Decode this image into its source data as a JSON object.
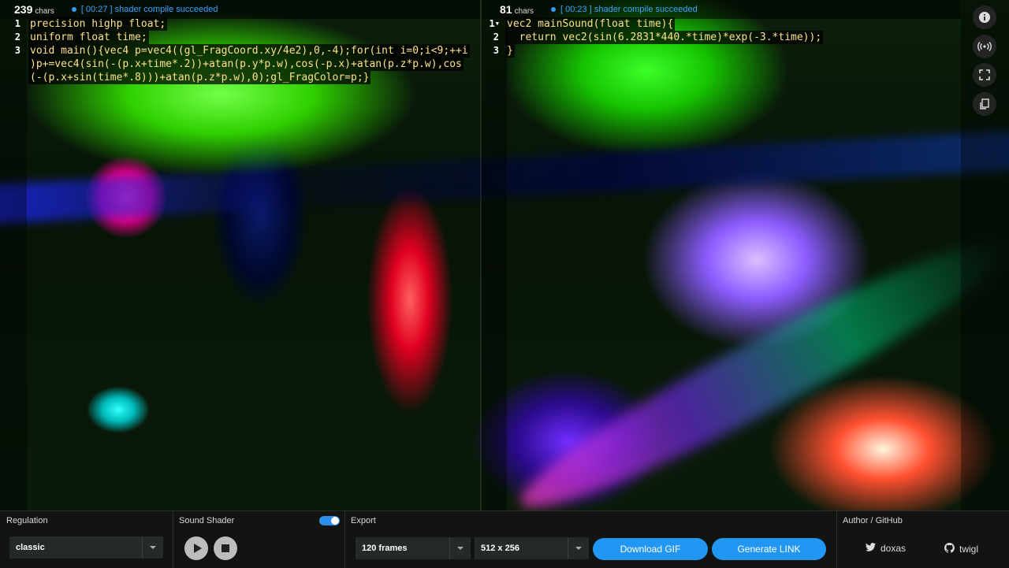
{
  "editor_left": {
    "char_count": "239",
    "char_unit": "chars",
    "status": "[ 00:27 ] shader compile succeeded",
    "lines": [
      {
        "no": "1",
        "text": "precision highp float;"
      },
      {
        "no": "2",
        "text": "uniform float time;"
      },
      {
        "no": "3",
        "text": "void main(){vec4 p=vec4((gl_FragCoord.xy/4e2),0,-4);for(int i=0;i<9;++i"
      },
      {
        "no": "",
        "text": ")p+=vec4(sin(-(p.x+time*.2))+atan(p.y*p.w),cos(-p.x)+atan(p.z*p.w),cos"
      },
      {
        "no": "",
        "text": "(-(p.x+sin(time*.8)))+atan(p.z*p.w),0);gl_FragColor=p;}"
      }
    ]
  },
  "editor_right": {
    "char_count": "81",
    "char_unit": "chars",
    "status": "[ 00:23 ] shader compile succeeded",
    "lines": [
      {
        "no": "1",
        "text": "vec2 mainSound(float time){"
      },
      {
        "no": "2",
        "text": "  return vec2(sin(6.2831*440.*time)*exp(-3.*time));"
      },
      {
        "no": "3",
        "text": "}"
      }
    ]
  },
  "rail": {
    "icons": [
      "info-icon",
      "broadcast-icon",
      "fullscreen-icon",
      "sync-icon"
    ]
  },
  "bottom": {
    "regulation": {
      "title": "Regulation",
      "value": "classic"
    },
    "sound": {
      "title": "Sound Shader",
      "toggle_on": true
    },
    "export": {
      "title": "Export",
      "frames": "120 frames",
      "size": "512 x 256",
      "download_label": "Download GIF",
      "link_label": "Generate LINK"
    },
    "author": {
      "title": "Author / GitHub",
      "twitter": "doxas",
      "github": "twigl"
    }
  },
  "colors": {
    "accent": "#2196f3",
    "status_blue": "#39a4ff",
    "code_text": "#ffe08a",
    "number_blue": "#3f9fff"
  }
}
